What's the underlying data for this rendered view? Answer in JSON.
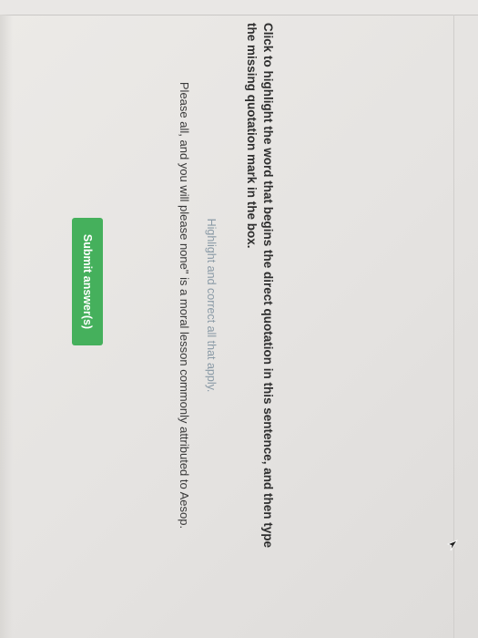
{
  "question": {
    "instruction": "Click to highlight the word that begins the direct quotation in this sentence, and then type the missing quotation mark in the box.",
    "hint": "Highlight and correct all that apply.",
    "sentence": "Please all, and you will please none\" is a moral lesson commonly attributed to Aesop."
  },
  "actions": {
    "submit_label": "Submit answer(s)"
  },
  "colors": {
    "submit_button": "#45b05c",
    "hint_text": "#8a9aa6"
  },
  "icons": {
    "pointer": "mouse-pointer-icon"
  }
}
